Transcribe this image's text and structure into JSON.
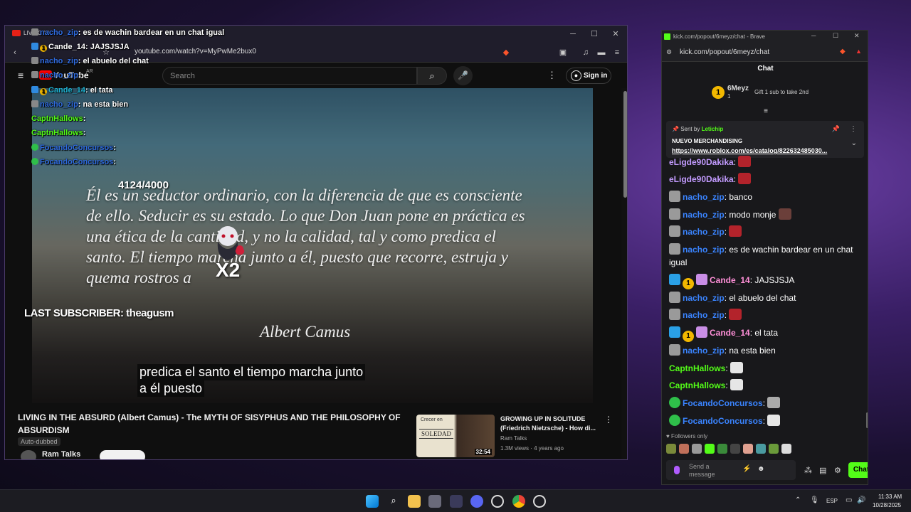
{
  "youtube_window": {
    "tab_title": "LIVING IN",
    "url": "youtube.com/watch?v=MyPwMe2bux0",
    "search_placeholder": "Search",
    "sign_in": "Sign in",
    "logo": "YouTube",
    "logo_country": "AR"
  },
  "video": {
    "quote": "Él es un seductor ordinario, con la diferencia de que es consciente de ello. Seducir es su estado. Lo que Don Juan pone en práctica es una ética de la cantidad, y no la calidad, tal y como predica el santo. El tiempo marcha junto a él, puesto que recorre, estruja y quema rostros a",
    "quote_author": "Albert Camus",
    "caption_line1": "predica el santo el tiempo marcha junto",
    "caption_line2": "a él puesto",
    "title": "LIVING IN THE ABSURD (Albert Camus) - The MYTH OF SISYPHUS AND THE PHILOSOPHY OF ABSURDISM",
    "auto_dubbed": "Auto-dubbed",
    "channel": "Ram Talks"
  },
  "recommended": {
    "title": "GROWING UP IN SOLITUDE (Friedrich Nietzsche) - How di...",
    "channel": "Ram Talks",
    "meta": "1.3M views · 4 years ago",
    "duration": "32:54",
    "thumb_top": "Crecer en",
    "thumb_word": "SOLEDAD"
  },
  "overlay": {
    "goal": "4124/4000",
    "last_subscriber": "LAST SUBSCRIBER: theagusm",
    "multiplier": "X2",
    "chat": [
      {
        "user": "nacho_zip",
        "text": ": es de wachin bardear en un chat igual",
        "color": "blue"
      },
      {
        "user": "Cande_14",
        "text": ": JAJSJSJA",
        "color": "white"
      },
      {
        "user": "nacho_zip",
        "text": ": el abuelo del chat",
        "color": "blue"
      },
      {
        "user": "nacho_zip",
        "text": ":",
        "color": "blue"
      },
      {
        "user": "Cande_14",
        "text": ": el tata",
        "color": "cyan"
      },
      {
        "user": "nacho_zip",
        "text": ": na esta bien",
        "color": "blue"
      },
      {
        "user": "CaptnHallows",
        "text": ":",
        "color": "green"
      },
      {
        "user": "CaptnHallows",
        "text": ":",
        "color": "green"
      },
      {
        "user": "FocandoConcursos",
        "text": ":",
        "color": "blue"
      },
      {
        "user": "FocandoConcursos",
        "text": ":",
        "color": "blue"
      }
    ]
  },
  "kick_window": {
    "title": "kick.com/popout/6meyz/chat - Brave",
    "url": "kick.com/popout/6meyz/chat",
    "header": "Chat",
    "sub_name": "6Meyz",
    "sub_count": "1",
    "sub_level": "1",
    "gift_text": "Gift 1 sub to take 2nd",
    "pinned_sent_by": "Sent by",
    "pinned_user": "Letichip",
    "pinned_title": "NUEVO MERCHANDISING",
    "pinned_link": "https://www.roblox.com/es/catalog/822632485030...",
    "followers_only": "Followers only",
    "input_placeholder": "Send a message",
    "chat_button": "Chat"
  },
  "kick_messages": [
    {
      "user": "eLigde90Dakika",
      "text": ":",
      "color": "purple"
    },
    {
      "user": "eLigde90Dakika",
      "text": ":",
      "color": "purple"
    },
    {
      "user": "nacho_zip",
      "text": ": banco",
      "color": "blue"
    },
    {
      "user": "nacho_zip",
      "text": ": modo monje",
      "color": "blue"
    },
    {
      "user": "nacho_zip",
      "text": ":",
      "color": "blue"
    },
    {
      "user": "nacho_zip",
      "text": ": es de wachin bardear en un chat igual",
      "color": "blue"
    },
    {
      "user": "Cande_14",
      "text": ": JAJSJSJA",
      "color": "pink"
    },
    {
      "user": "nacho_zip",
      "text": ": el abuelo del chat",
      "color": "blue"
    },
    {
      "user": "nacho_zip",
      "text": ":",
      "color": "blue"
    },
    {
      "user": "Cande_14",
      "text": ": el tata",
      "color": "pink"
    },
    {
      "user": "nacho_zip",
      "text": ": na esta bien",
      "color": "blue"
    },
    {
      "user": "CaptnHallows",
      "text": ":",
      "color": "green"
    },
    {
      "user": "CaptnHallows",
      "text": ":",
      "color": "green"
    },
    {
      "user": "FocandoConcursos",
      "text": ":",
      "color": "blue"
    },
    {
      "user": "FocandoConcursos",
      "text": ":",
      "color": "blue"
    }
  ],
  "taskbar": {
    "language": "ESP",
    "time": "11:33 AM",
    "date": "10/28/2025"
  },
  "colors": {
    "kick_green": "#53fc18",
    "username_blue": "#3a84ff",
    "username_purple": "#c39bff",
    "username_pink": "#ff8fd8"
  }
}
